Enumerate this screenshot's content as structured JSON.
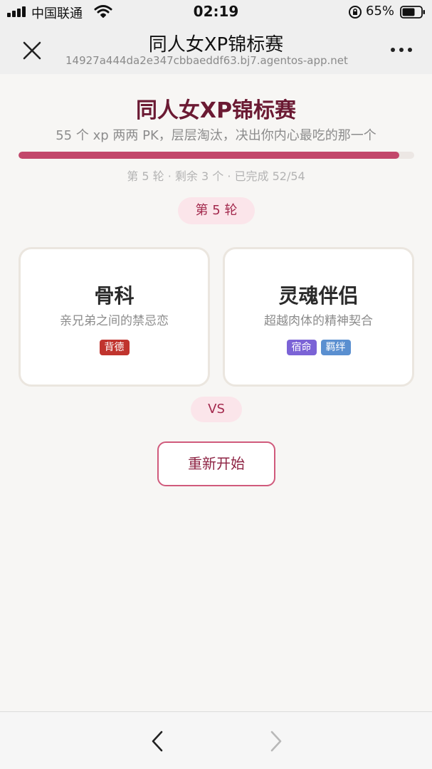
{
  "status_bar": {
    "carrier": "中国联通",
    "time": "02:19",
    "battery_percent": "65%",
    "icons": [
      "signal-icon",
      "wifi-icon",
      "orientation-lock-icon",
      "battery-icon"
    ]
  },
  "nav": {
    "title": "同人女XP锦标赛",
    "url": "14927a444da2e347cbbaeddf63.bj7.agentos-app.net",
    "icons": [
      "close-icon",
      "more-icon"
    ]
  },
  "main": {
    "title": "同人女XP锦标赛",
    "subtitle": "55 个 xp 两两 PK，层层淘汰，决出你内心最吃的那一个",
    "progress": {
      "completed": 52,
      "total": 54,
      "text": "第 5 轮 · 剩余 3 个 · 已完成 52/54"
    },
    "round_label": "第 5 轮",
    "vs_label": "VS",
    "restart_label": "重新开始",
    "cards": [
      {
        "title": "骨科",
        "description": "亲兄弟之间的禁忌恋",
        "tags": [
          {
            "label": "背德",
            "color": "#c0342e"
          }
        ]
      },
      {
        "title": "灵魂伴侣",
        "description": "超越肉体的精神契合",
        "tags": [
          {
            "label": "宿命",
            "color": "#7b63d6"
          },
          {
            "label": "羁绊",
            "color": "#5a8fd0"
          }
        ]
      }
    ]
  },
  "colors": {
    "accent": "#c2476b",
    "title": "#6b1a33",
    "pill_bg": "#fbe5ea"
  },
  "bottom_bar": {
    "icons": [
      "back-arrow-icon",
      "forward-arrow-icon"
    ]
  }
}
